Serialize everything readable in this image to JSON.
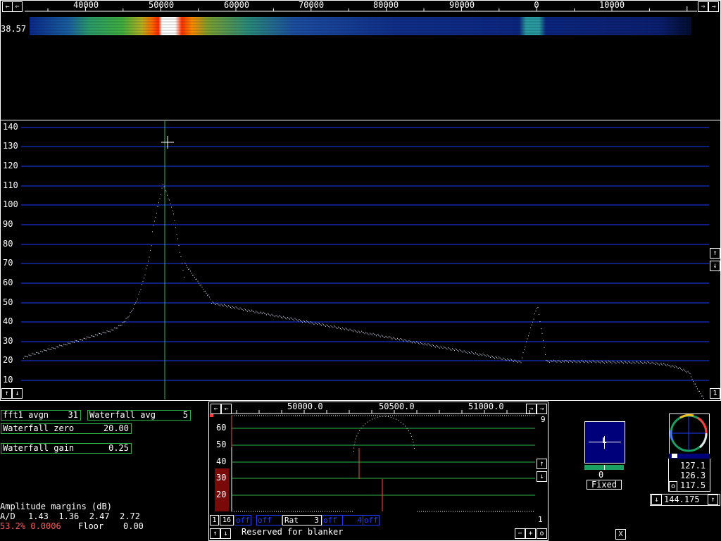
{
  "waterfall": {
    "freq_labels": [
      "40000",
      "50000",
      "60000",
      "70000",
      "80000",
      "90000",
      "0",
      "10000"
    ],
    "level_readout": "38.57"
  },
  "spectrum": {
    "y_labels": [
      "140",
      "130",
      "120",
      "110",
      "100",
      "90",
      "80",
      "70",
      "60",
      "50",
      "40",
      "30",
      "20",
      "10"
    ],
    "corner_label": "1"
  },
  "params": {
    "fft1_avgn_label": "fft1 avgn",
    "fft1_avgn_value": "31",
    "waterfall_avg_label": "Waterfall avg",
    "waterfall_avg_value": "5",
    "waterfall_zero_label": "Waterfall zero",
    "waterfall_zero_value": "20.00",
    "waterfall_gain_label": "Waterfall gain",
    "waterfall_gain_value": "0.25"
  },
  "status": {
    "amp_margins": "Amplitude margins (dB)",
    "ad_label": "A/D",
    "ad_values": "1.43  1.36  2.47  2.72",
    "cpu_load": "53.2% 0.0006",
    "floor_label": "Floor",
    "floor_value": "0.00"
  },
  "baseband": {
    "freq_labels": [
      "50000.0",
      "50500.0",
      "51000.0"
    ],
    "y_labels": [
      "60",
      "50",
      "40",
      "30",
      "20"
    ],
    "top_right": "9",
    "bottom_right": "1",
    "num1": "1",
    "num16": "16",
    "off_labels": [
      "off",
      "off",
      "off",
      "4",
      "off"
    ],
    "rat_label": "Rat",
    "rat_value": "3",
    "blanker_text": "Reserved for blanker"
  },
  "smeter": {
    "letter": "L",
    "value": "0",
    "mode": "Fixed"
  },
  "phase": {
    "r1": "127.1",
    "r2": "126.3",
    "o_label": "o",
    "r3": "117.5",
    "freq": "144.175"
  },
  "close_label": "X",
  "colors": {
    "grid_blue": "#1e3cff",
    "green": "#2bb34a",
    "red": "#ff3b3b"
  }
}
